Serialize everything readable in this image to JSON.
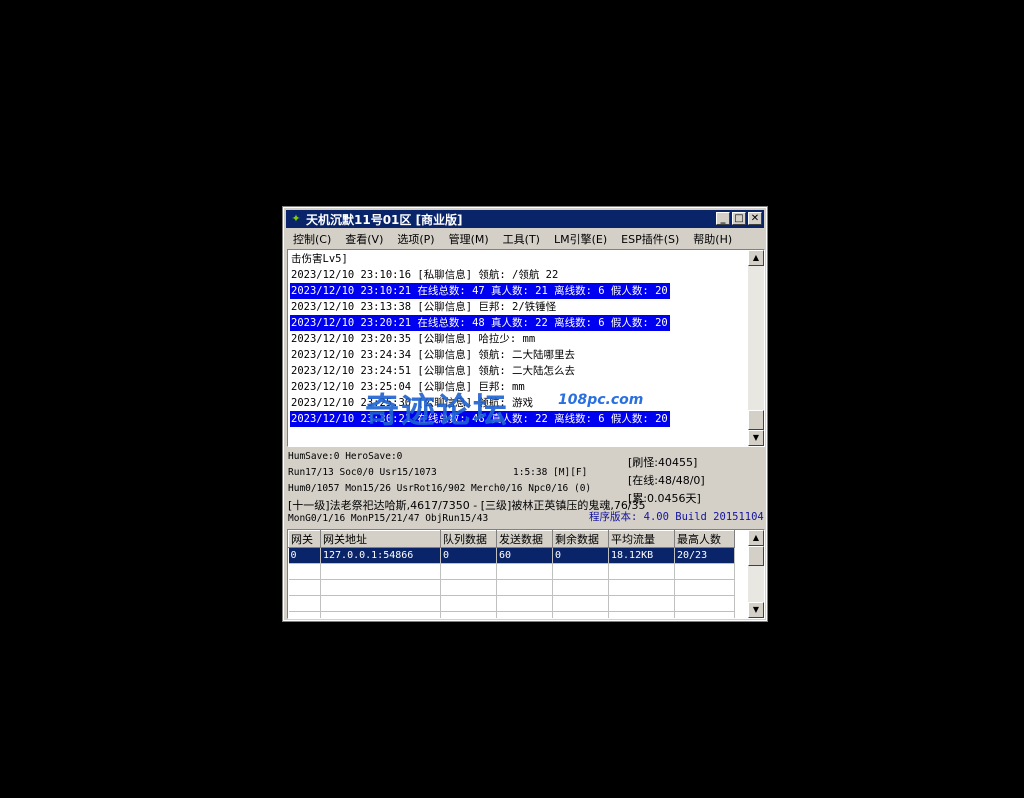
{
  "window": {
    "title": "天机沉默11号01区 [商业版]",
    "minimize": "_",
    "maximize": "□",
    "close": "✕"
  },
  "menu": [
    "控制(C)",
    "查看(V)",
    "选项(P)",
    "管理(M)",
    "工具(T)",
    "LM引擎(E)",
    "ESP插件(S)",
    "帮助(H)"
  ],
  "log": [
    {
      "text": "击伤害Lv5]",
      "hl": false
    },
    {
      "text": "2023/12/10 23:10:16 [私聊信息] 领航: /领航 22",
      "hl": false
    },
    {
      "text": "2023/12/10 23:10:21 在线总数: 47 真人数: 21 离线数: 6 假人数: 20",
      "hl": true
    },
    {
      "text": "2023/12/10 23:13:38 [公聊信息] 巨邦: 2/铁锤怪",
      "hl": false
    },
    {
      "text": "2023/12/10 23:20:21 在线总数: 48 真人数: 22 离线数: 6 假人数: 20",
      "hl": true
    },
    {
      "text": "2023/12/10 23:20:35 [公聊信息] 哈拉少: mm",
      "hl": false
    },
    {
      "text": "2023/12/10 23:24:34 [公聊信息] 领航: 二大陆哪里去",
      "hl": false
    },
    {
      "text": "2023/12/10 23:24:51 [公聊信息] 领航: 二大陆怎么去",
      "hl": false
    },
    {
      "text": "2023/12/10 23:25:04 [公聊信息] 巨邦: mm",
      "hl": false
    },
    {
      "text": "2023/12/10 23:25:30 [公聊信息] 领航: 游戏",
      "hl": false
    },
    {
      "text": "2023/12/10 23:30:21 在线总数: 48 真人数: 22 离线数: 6 假人数: 20",
      "hl": true
    }
  ],
  "status": {
    "line1": "HumSave:0 HeroSave:0",
    "line2": "Run17/13 Soc0/0 Usr15/1073",
    "line2b": "1:5:38 [M][F]",
    "line3": "Hum0/1057 Mon15/26 UsrRot16/902 Merch0/16 Npc0/16 (0)",
    "line4": "[十一级]法老祭祀达哈斯,4617/7350 - [三级]被林正英镇压的鬼魂,76/35",
    "line5": "MonG0/1/16 MonP15/21/47 ObjRun15/43",
    "refresh": "[刷怪:40455]",
    "online": "[在线:48/48/0]",
    "cumulative": "[累:0.0456天]",
    "version": "程序版本: 4.00 Build 20151104"
  },
  "gateway": {
    "columns": [
      "网关",
      "网关地址",
      "队列数据",
      "发送数据",
      "剩余数据",
      "平均流量",
      "最高人数"
    ],
    "rows": [
      [
        "0",
        "127.0.0.1:54866",
        "0",
        "60",
        "0",
        "18.12KB",
        "20/23"
      ]
    ],
    "empty_rows": 4
  },
  "watermark": {
    "text": "奇迹论坛",
    "url": "108pc.com"
  },
  "colors": {
    "titlebar": "#0a246a",
    "highlight": "#0000f0",
    "version_text": "#1414a0"
  }
}
